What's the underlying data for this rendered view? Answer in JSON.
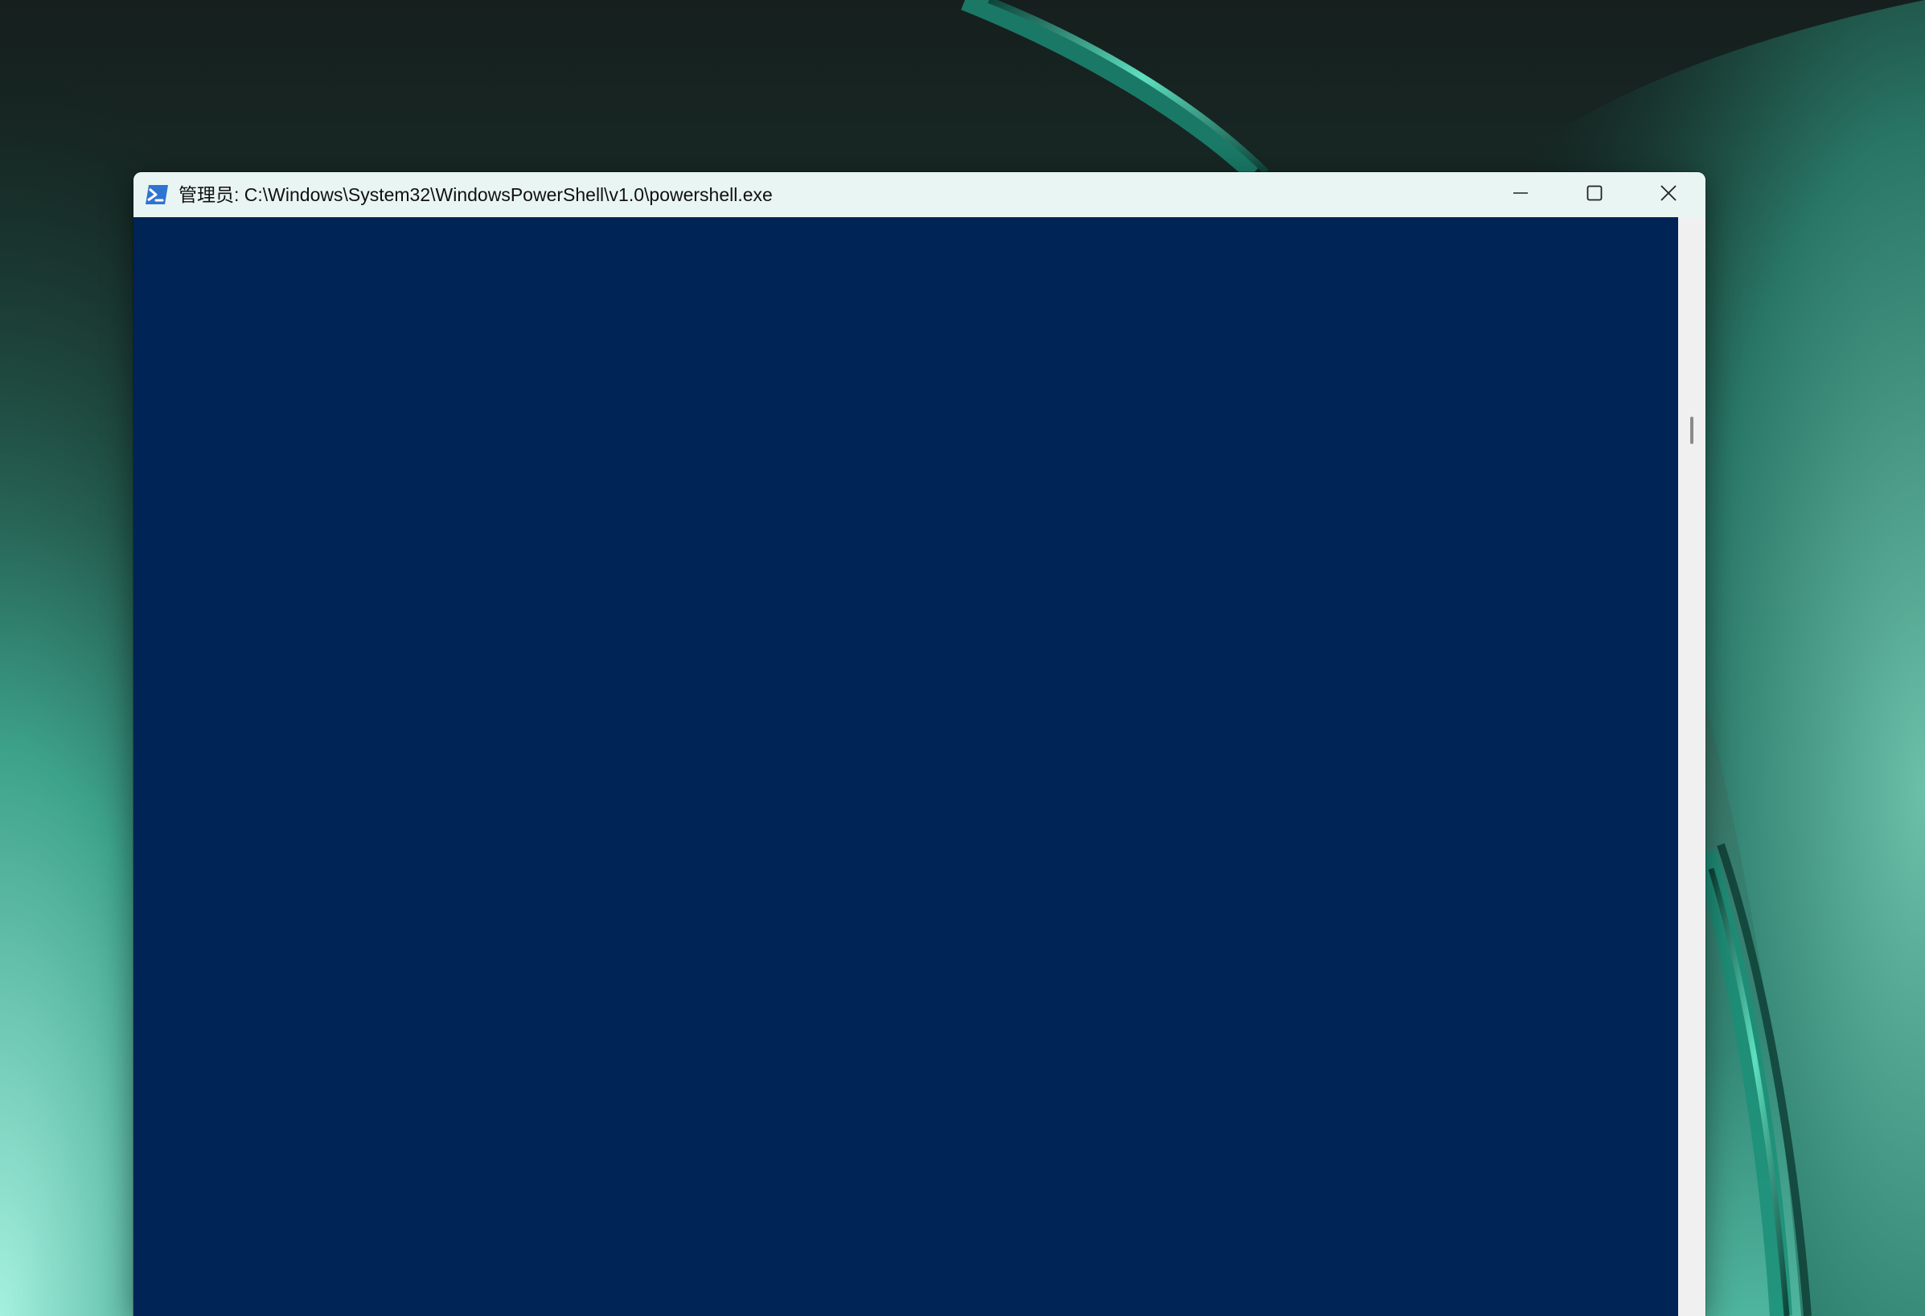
{
  "window": {
    "title": "管理员: C:\\Windows\\System32\\WindowsPowerShell\\v1.0\\powershell.exe",
    "app_icon": "powershell-icon",
    "controls": {
      "minimize_icon": "minimize-icon",
      "maximize_icon": "maximize-icon",
      "close_icon": "close-icon"
    }
  },
  "console": {
    "background_color": "#012456",
    "text": ""
  },
  "colors": {
    "titlebar": "#e9f5f2",
    "console_background": "#012456",
    "wallpaper_accent": "#2fb898"
  }
}
